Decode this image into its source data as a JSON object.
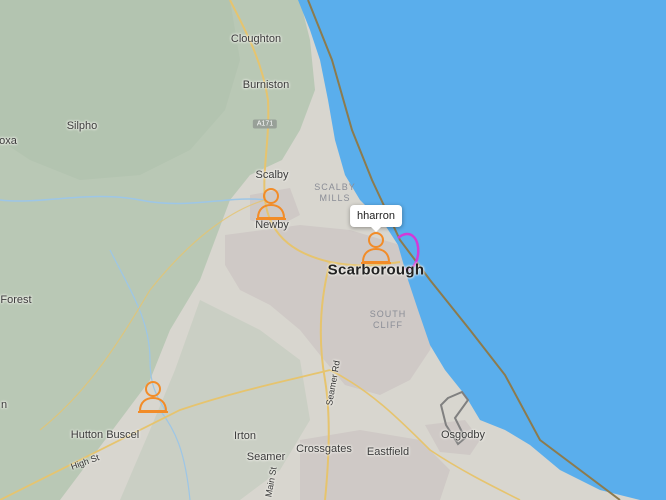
{
  "map": {
    "colors": {
      "sea": "#5aaeec",
      "land": "#d8d6cf",
      "green": "#b9c8b5",
      "urban": "#cfc9c6",
      "road": "#e6c46e",
      "boundary": "#8c7b4e",
      "marker": "#f28c28",
      "track": "#d23ad8"
    },
    "labels": {
      "cloughton": "Cloughton",
      "burniston": "Burniston",
      "silpho": "Silpho",
      "oxa": "oxa",
      "scalby": "Scalby",
      "newby": "Newby",
      "scalby_mills_1": "SCALBY",
      "scalby_mills_2": "MILLS",
      "scarborough": "Scarborough",
      "south_cliff_1": "SOUTH",
      "south_cliff_2": "CLIFF",
      "forest": "Forest",
      "edge_n": "n",
      "hutton_buscel": "Hutton Buscel",
      "irton": "Irton",
      "seamer": "Seamer",
      "crossgates": "Crossgates",
      "eastfield": "Eastfield",
      "osgodby": "Osgodby",
      "high_st": "High St",
      "seamer_rd": "Seamer Rd",
      "main_st": "Main St",
      "a171": "A171"
    },
    "tooltip": "hharron",
    "markers": [
      {
        "name": "user-marker-newby",
        "icon": "person-icon"
      },
      {
        "name": "user-marker-scarborough",
        "icon": "person-icon"
      },
      {
        "name": "user-marker-hutton-buscel",
        "icon": "person-icon"
      }
    ]
  }
}
